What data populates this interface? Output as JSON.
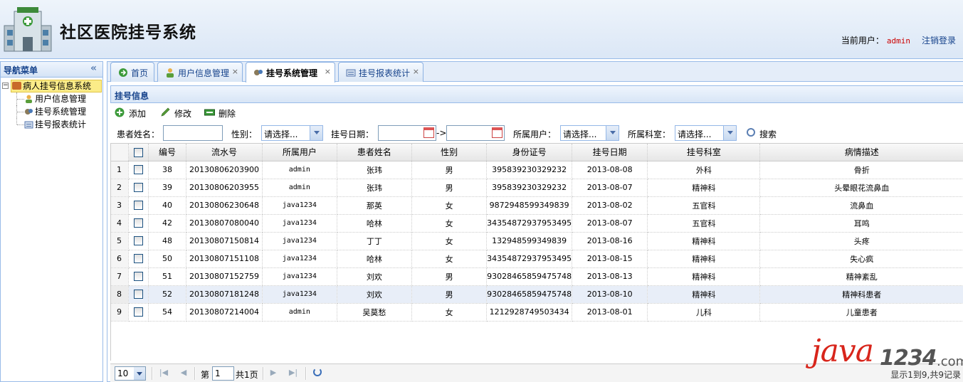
{
  "header": {
    "title": "社区医院挂号系统",
    "current_user_label": "当前用户：",
    "current_user": "admin",
    "logout_label": "注销登录"
  },
  "sidebar": {
    "title": "导航菜单",
    "collapse_icon": "«",
    "root": "病人挂号信息系统",
    "items": [
      {
        "label": "用户信息管理",
        "icon": "user-icon"
      },
      {
        "label": "挂号系统管理",
        "icon": "gear-icon"
      },
      {
        "label": "挂号报表统计",
        "icon": "report-icon"
      }
    ]
  },
  "tabs": [
    {
      "label": "首页",
      "icon": "home-icon",
      "closable": false
    },
    {
      "label": "用户信息管理",
      "icon": "user-icon",
      "closable": true
    },
    {
      "label": "挂号系统管理",
      "icon": "gear-icon",
      "closable": true,
      "active": true
    },
    {
      "label": "挂号报表统计",
      "icon": "report-icon",
      "closable": true
    }
  ],
  "tab_close_glyph": "×",
  "panel": {
    "title": "挂号信息"
  },
  "toolbar": {
    "add_label": "添加",
    "edit_label": "修改",
    "delete_label": "删除"
  },
  "search": {
    "patient_name_label": "患者姓名：",
    "gender_label": "性别：",
    "gender_value": "请选择...",
    "date_label": "挂号日期：",
    "date_arrow": "->",
    "user_label": "所属用户：",
    "user_value": "请选择...",
    "dept_label": "所属科室：",
    "dept_value": "请选择...",
    "search_label": "搜索"
  },
  "table": {
    "columns": [
      "编号",
      "流水号",
      "所属用户",
      "患者姓名",
      "性别",
      "身份证号",
      "挂号日期",
      "挂号科室",
      "病情描述"
    ],
    "rows": [
      {
        "n": "1",
        "id": "38",
        "serial": "20130806203900",
        "user": "admin",
        "name": "张玮",
        "gender": "男",
        "idcard": "395839230329232",
        "date": "2013-08-08",
        "dept": "外科",
        "desc": "骨折"
      },
      {
        "n": "2",
        "id": "39",
        "serial": "20130806203955",
        "user": "admin",
        "name": "张玮",
        "gender": "男",
        "idcard": "395839230329232",
        "date": "2013-08-07",
        "dept": "精神科",
        "desc": "头晕眼花流鼻血"
      },
      {
        "n": "3",
        "id": "40",
        "serial": "20130806230648",
        "user": "java1234",
        "name": "那英",
        "gender": "女",
        "idcard": "9872948599349839",
        "date": "2013-08-02",
        "dept": "五官科",
        "desc": "流鼻血"
      },
      {
        "n": "4",
        "id": "42",
        "serial": "20130807080040",
        "user": "java1234",
        "name": "哈林",
        "gender": "女",
        "idcard": "34354872937953495",
        "date": "2013-08-07",
        "dept": "五官科",
        "desc": "耳鸣"
      },
      {
        "n": "5",
        "id": "48",
        "serial": "20130807150814",
        "user": "java1234",
        "name": "丁丁",
        "gender": "女",
        "idcard": "132948599349839",
        "date": "2013-08-16",
        "dept": "精神科",
        "desc": "头疼"
      },
      {
        "n": "6",
        "id": "50",
        "serial": "20130807151108",
        "user": "java1234",
        "name": "哈林",
        "gender": "女",
        "idcard": "34354872937953495",
        "date": "2013-08-15",
        "dept": "精神科",
        "desc": "失心疯"
      },
      {
        "n": "7",
        "id": "51",
        "serial": "20130807152759",
        "user": "java1234",
        "name": "刘欢",
        "gender": "男",
        "idcard": "93028465859475748",
        "date": "2013-08-13",
        "dept": "精神科",
        "desc": "精神紊乱"
      },
      {
        "n": "8",
        "id": "52",
        "serial": "20130807181248",
        "user": "java1234",
        "name": "刘欢",
        "gender": "男",
        "idcard": "93028465859475748",
        "date": "2013-08-10",
        "dept": "精神科",
        "desc": "精神科患者"
      },
      {
        "n": "9",
        "id": "54",
        "serial": "20130807214004",
        "user": "admin",
        "name": "吴莫愁",
        "gender": "女",
        "idcard": "1212928749503434",
        "date": "2013-08-01",
        "dept": "儿科",
        "desc": "儿童患者"
      }
    ]
  },
  "pager": {
    "page_size": "10",
    "page_label": "第",
    "page_value": "1",
    "total_pages": "共1页",
    "info": "显示1到9,共9记录"
  },
  "watermark": {
    "part1": "java",
    "part2": "1234",
    "part3": ".com"
  },
  "colors": {
    "accent": "#15428b",
    "border": "#99bbe8",
    "tree_selected": "#fbec88",
    "watermark_red": "#d8251b"
  }
}
